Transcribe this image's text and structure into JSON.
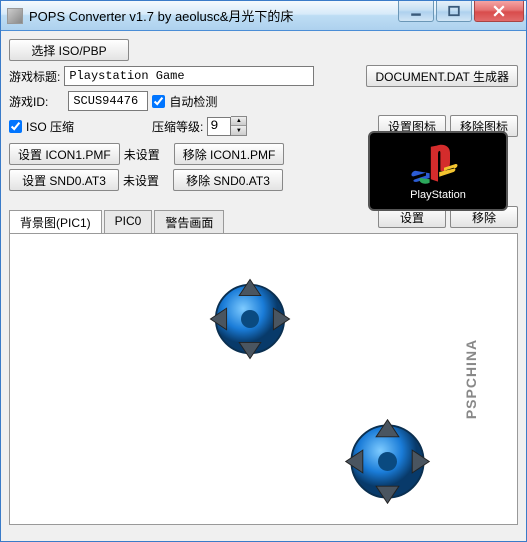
{
  "window": {
    "title": "POPS Converter v1.7 by aeolusc&月光下的床"
  },
  "toolbar": {
    "select_iso_pbp": "选择 ISO/PBP",
    "doc_dat_gen": "DOCUMENT.DAT 生成器",
    "set_icon": "设置图标",
    "remove_icon": "移除图标"
  },
  "labels": {
    "game_title": "游戏标题:",
    "game_id": "游戏ID:",
    "auto_detect": "自动检测",
    "iso_compress": "ISO 压缩",
    "compress_level": "压缩等级:",
    "not_set": "未设置"
  },
  "fields": {
    "game_title": "Playstation Game",
    "game_id": "SCUS94476",
    "compress_level": "9",
    "auto_detect_checked": true,
    "iso_compress_checked": true
  },
  "pmf": {
    "set_icon1": "设置 ICON1.PMF",
    "remove_icon1": "移除 ICON1.PMF",
    "set_snd0": "设置 SND0.AT3",
    "remove_snd0": "移除 SND0.AT3"
  },
  "tabs": {
    "pic1": "背景图(PIC1)",
    "pic0": "PIC0",
    "warning": "警告画面",
    "set": "设置",
    "remove": "移除"
  },
  "pslogo": {
    "text": "PlayStation"
  },
  "watermark": "PSPCHINA"
}
